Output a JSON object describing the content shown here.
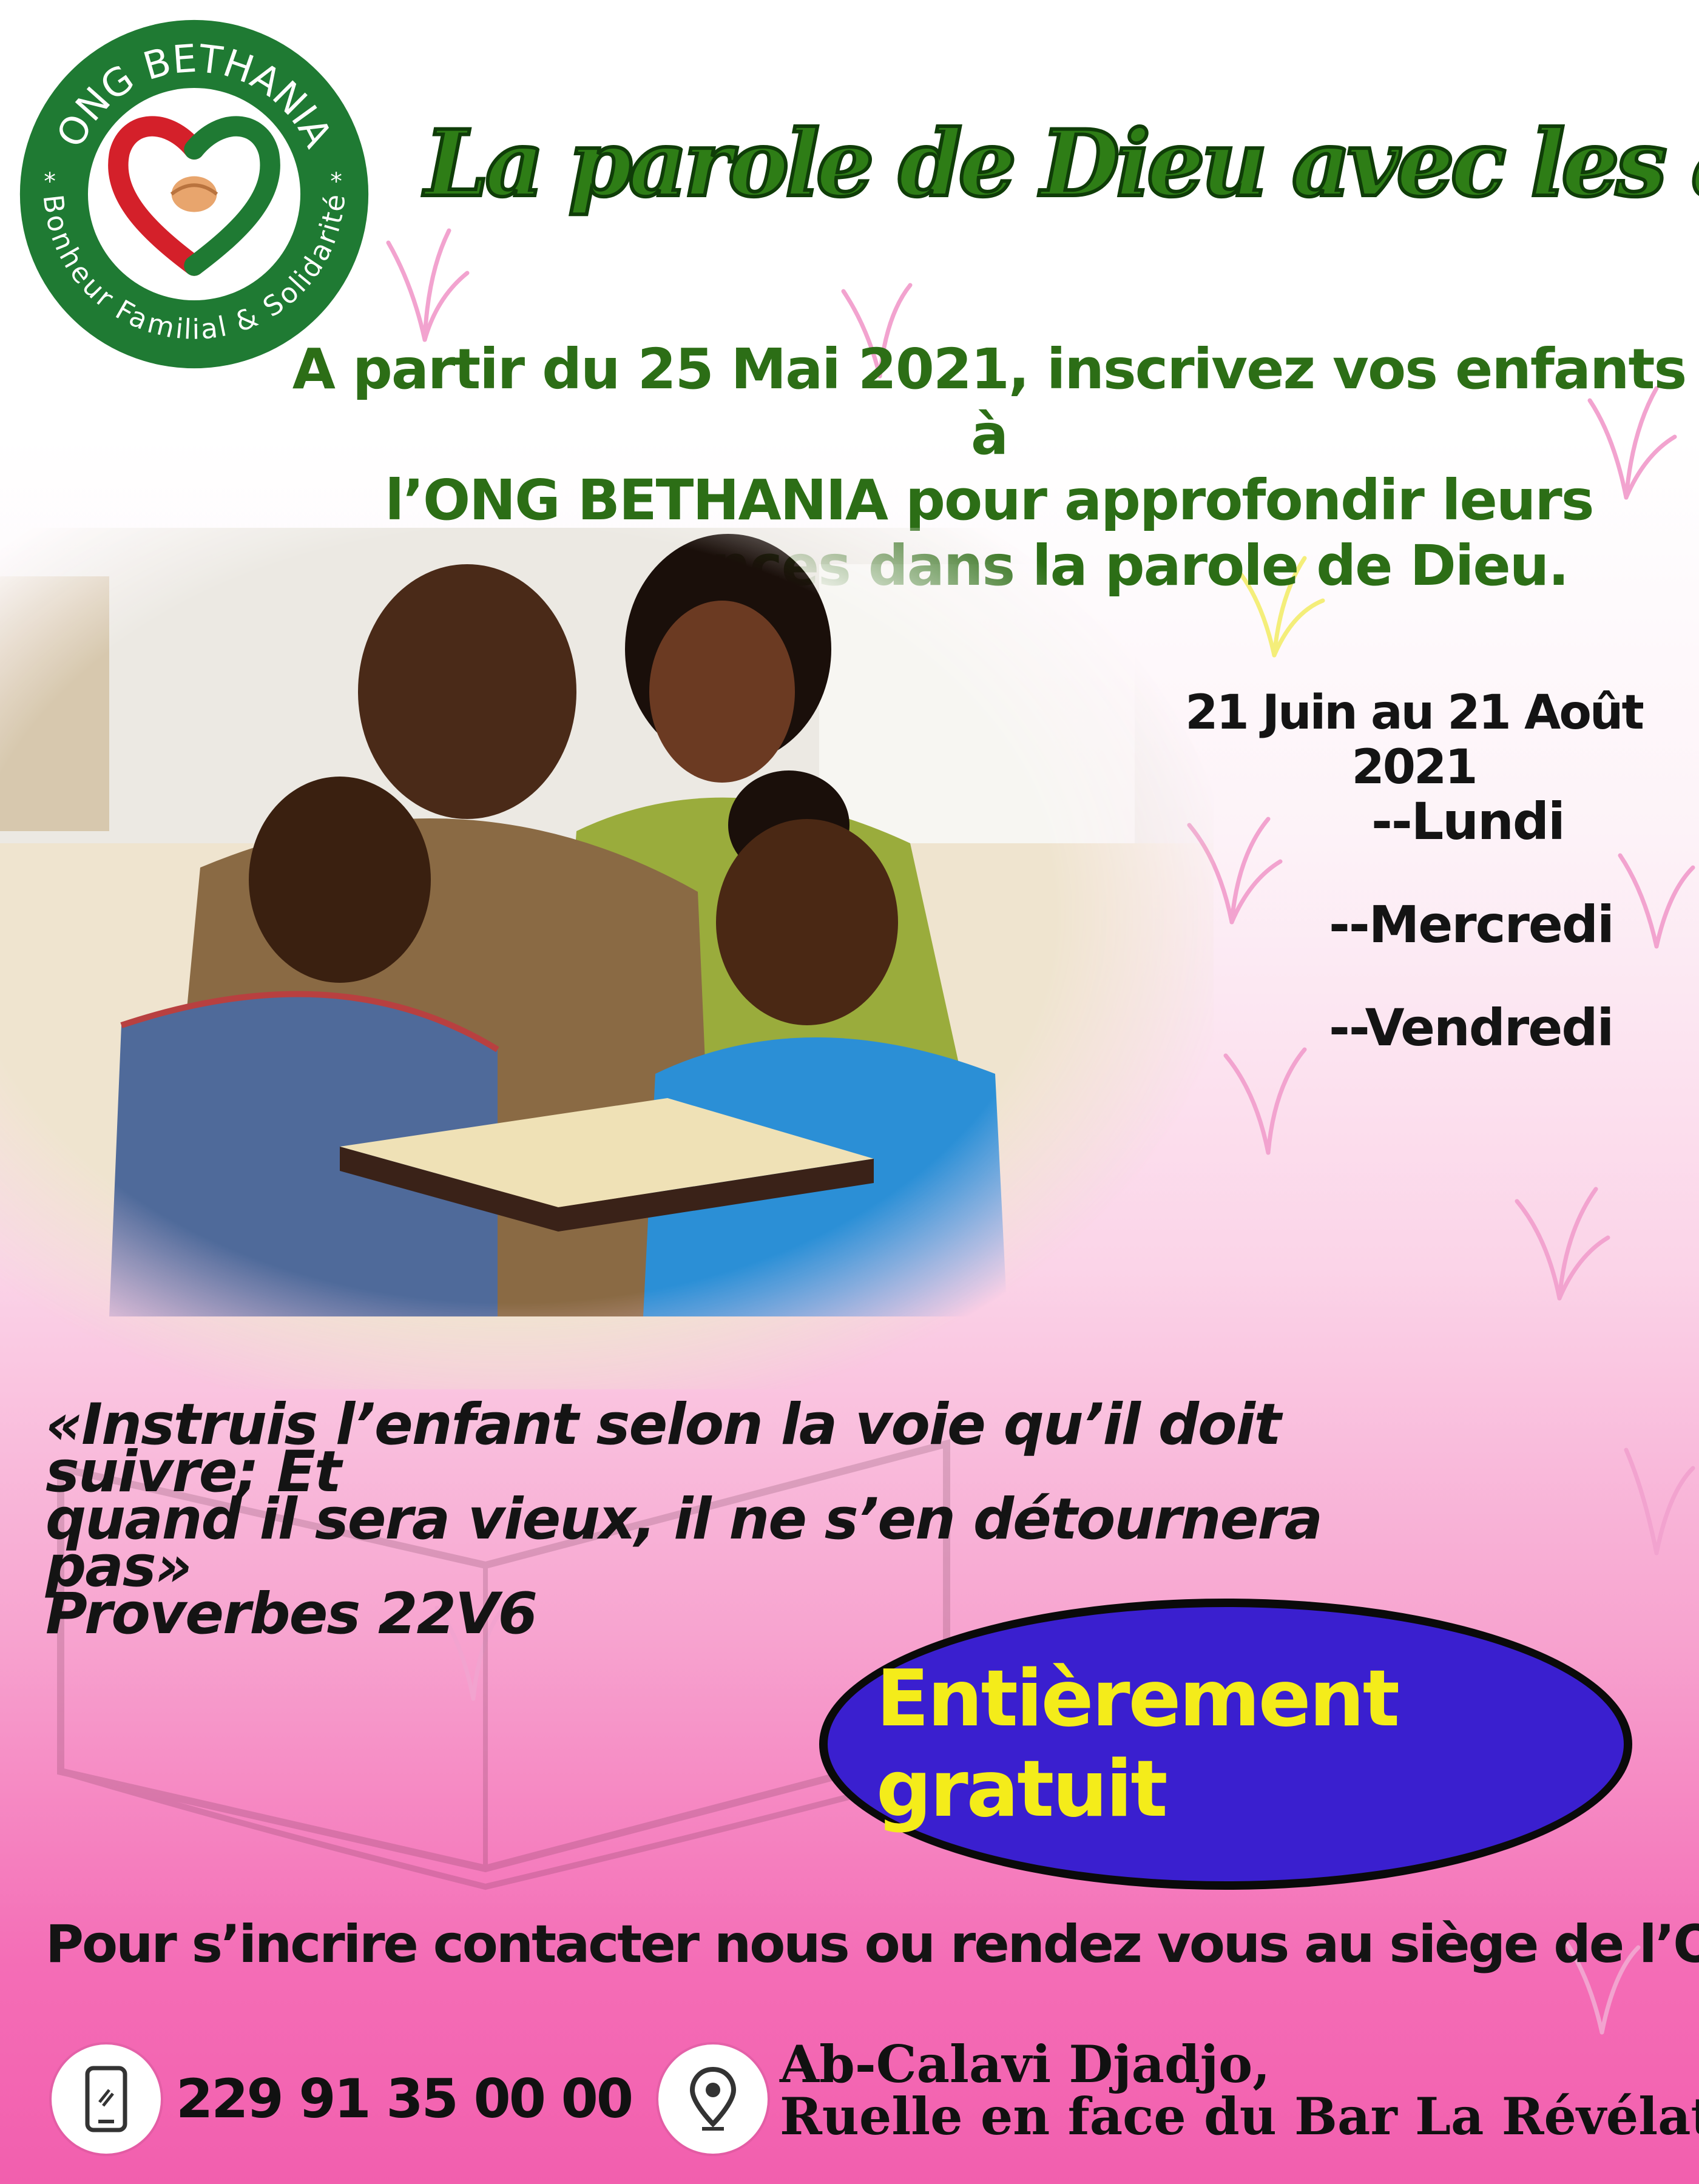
{
  "logo": {
    "top_text": "ONG BETHANIA",
    "bottom_text": "Bonheur Familial & Solidarité",
    "icon": "heart-hands-icon"
  },
  "headline": "La parole de Dieu avec les anfants",
  "intro": {
    "lines": [
      "A partir du 25 Mai 2021, inscrivez vos enfants à",
      "l’ONG BETHANIA pour approfondir leurs",
      "connaissances dans la parole de Dieu."
    ]
  },
  "schedule": {
    "dates": "21 Juin au 21 Août 2021",
    "days": [
      "--Lundi",
      "--Mercredi",
      "--Vendredi"
    ]
  },
  "quote": {
    "lines": [
      "«Instruis l’enfant selon la voie qu’il doit suivre; Et",
      "quand il sera vieux, il ne s’en détournera pas»",
      "Proverbes 22V6"
    ]
  },
  "free_badge": "Entièrement gratuit",
  "contact_line": "Pour s’incrire contacter nous ou rendez vous au siège de l’ONG",
  "footer": {
    "phone_icon": "phone-icon",
    "phone": "229 91 35 00 00",
    "location_icon": "location-pin-icon",
    "address_lines": [
      "Ab-Calavi Djadjo,",
      "Ruelle en face du Bar La Révélation"
    ]
  },
  "colors": {
    "headline_green": "#2e7d16",
    "intro_green": "#2c6e16",
    "badge_blue": "#3a1fcf",
    "badge_text_yellow": "#f4ec1a",
    "pink_background": "#f25fae",
    "logo_red": "#d4202a",
    "logo_green": "#1f7a33"
  }
}
